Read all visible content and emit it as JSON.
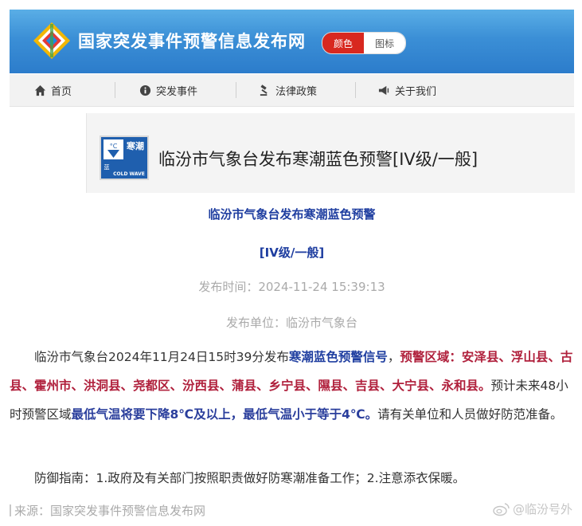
{
  "header": {
    "site_title": "国家突发事件预警信息发布网",
    "mode_toggle": [
      "颜色",
      "图标"
    ]
  },
  "nav": {
    "items": [
      {
        "label": "首页",
        "icon": "home-icon"
      },
      {
        "label": "突发事件",
        "icon": "info-icon"
      },
      {
        "label": "法律政策",
        "icon": "gavel-icon"
      },
      {
        "label": "关于我们",
        "icon": "megaphone-icon"
      }
    ]
  },
  "banner": {
    "title": "临汾市气象台发布寒潮蓝色预警[IV级/一般]",
    "icon_text_cn": "寒潮",
    "icon_text_en": "COLD WAVE",
    "icon_level": "蓝",
    "icon_temp": "°C"
  },
  "article": {
    "title": "临汾市气象台发布寒潮蓝色预警",
    "level": "[IV级/一般]",
    "publish_time": "发布时间：2024-11-24 15:39:13",
    "publisher": "发布单位：临汾市气象台",
    "p1_intro": "临汾市气象台2024年11月24日15时39分发布",
    "p1_signal": "寒潮蓝色预警信号",
    "p1_comma": "，",
    "p1_area": "预警区域：安泽县、浮山县、古县、霍州市、洪洞县、尧都区、汾西县、蒲县、乡宁县、隰县、吉县、大宁县、永和县。",
    "p1_forecast": "预计未来48小时预警区域",
    "p1_temp": "最低气温将要下降8℃及以上，最低气温小于等于4℃。",
    "p1_advice": "请有关单位和人员做好防范准备。",
    "p2": "防御指南：1.政府及有关部门按照职责做好防寒潮准备工作；2.注意添衣保暖。"
  },
  "footer": {
    "source": "来源：国家突发事件预警信息发布网",
    "watermark": "@临汾号外"
  },
  "colors": {
    "header_blue": "#3b8fd6",
    "warning_blue": "#1f3ea0",
    "warning_red": "#b0203c",
    "toggle_red": "#d8281f"
  }
}
